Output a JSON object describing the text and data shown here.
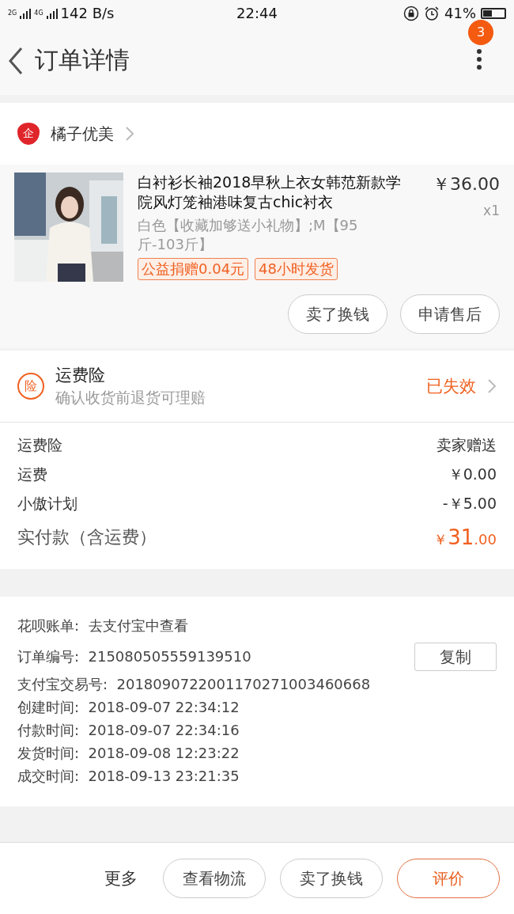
{
  "status_bar": {
    "network_1": "2G",
    "network_2": "4G",
    "speed": "142 B/s",
    "time": "22:44",
    "battery_text": "41%"
  },
  "header": {
    "title": "订单详情",
    "badge": "3"
  },
  "shop": {
    "name": "橘子优美",
    "icon_text": "企"
  },
  "product": {
    "title": "白衬衫长袖2018早秋上衣女韩范新款学院风灯笼袖港味复古chic衬衣",
    "price": "￥36.00",
    "quantity": "x1",
    "spec": "白色【收藏加够送小礼物】;M【95斤-103斤】",
    "tags": [
      "公益捐赠0.04元",
      "48小时发货"
    ],
    "buttons": [
      "卖了换钱",
      "申请售后"
    ]
  },
  "insurance": {
    "icon_text": "险",
    "title": "运费险",
    "subtitle": "确认收货前退货可理赔",
    "status": "已失效"
  },
  "fees": [
    {
      "label": "运费险",
      "value": "卖家赠送"
    },
    {
      "label": "运费",
      "value": "￥0.00"
    },
    {
      "label": "小傲计划",
      "value": "-￥5.00"
    }
  ],
  "total": {
    "label": "实付款（含运费）",
    "currency": "￥",
    "integer": "31",
    "decimal": ".00"
  },
  "info": [
    {
      "label": "花呗账单:",
      "value": "去支付宝中查看"
    },
    {
      "label": "订单编号:",
      "value": "215080505559139510",
      "action": "复制"
    },
    {
      "label": "支付宝交易号:",
      "value": "2018090722001170271003460668"
    },
    {
      "label": "创建时间:",
      "value": "2018-09-07 22:34:12"
    },
    {
      "label": "付款时间:",
      "value": "2018-09-07 22:34:16"
    },
    {
      "label": "发货时间:",
      "value": "2018-09-08 12:23:22"
    },
    {
      "label": "成交时间:",
      "value": "2018-09-13 23:21:35"
    }
  ],
  "bottom_bar": {
    "more": "更多",
    "buttons": [
      {
        "label": "查看物流",
        "primary": false
      },
      {
        "label": "卖了换钱",
        "primary": false
      },
      {
        "label": "评价",
        "primary": true
      }
    ]
  }
}
